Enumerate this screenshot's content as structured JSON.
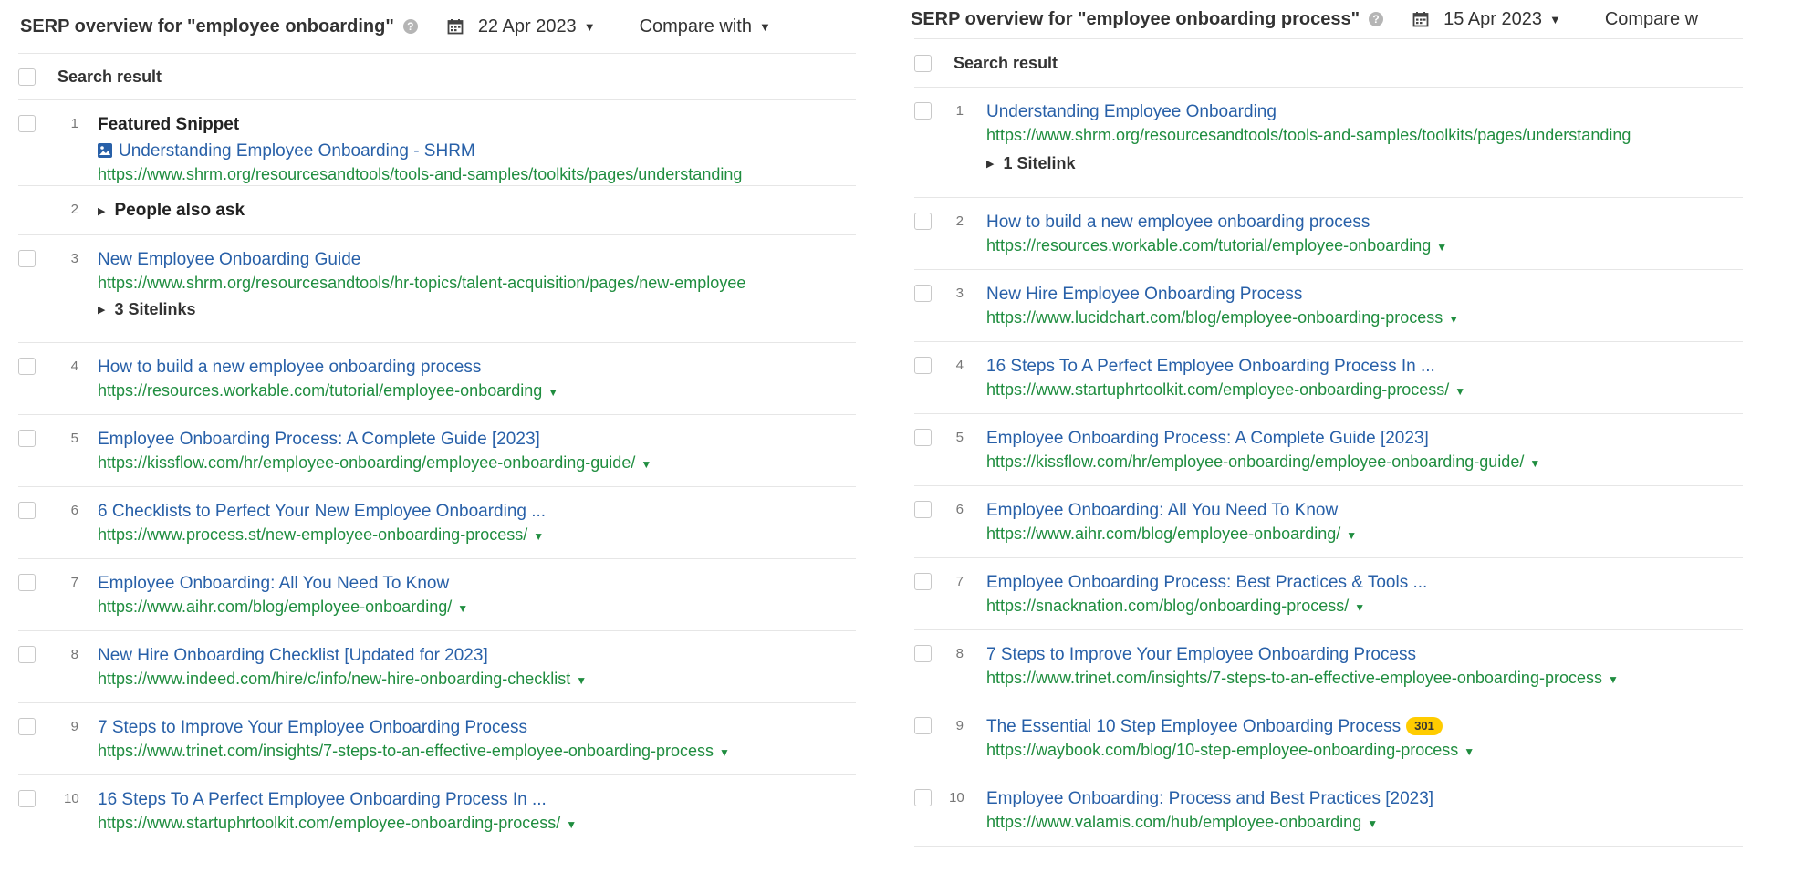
{
  "left": {
    "title": "SERP overview for \"employee onboarding\"",
    "date": "22 Apr 2023",
    "compare_label": "Compare with",
    "column_header": "Search result",
    "rows": [
      {
        "num": "1",
        "label": "Featured Snippet",
        "title": "Understanding Employee Onboarding - SHRM",
        "url": "https://www.shrm.org/resourcesandtools/tools-and-samples/toolkits/pages/understanding"
      },
      {
        "num": "2",
        "label": "People also ask"
      },
      {
        "num": "3",
        "title": "New Employee Onboarding Guide",
        "url": "https://www.shrm.org/resourcesandtools/hr-topics/talent-acquisition/pages/new-employee",
        "sitelinks": "3 Sitelinks"
      },
      {
        "num": "4",
        "title": "How to build a new employee onboarding process",
        "url": "https://resources.workable.com/tutorial/employee-onboarding"
      },
      {
        "num": "5",
        "title": "Employee Onboarding Process: A Complete Guide [2023]",
        "url": "https://kissflow.com/hr/employee-onboarding/employee-onboarding-guide/"
      },
      {
        "num": "6",
        "title": "6 Checklists to Perfect Your New Employee Onboarding ...",
        "url": "https://www.process.st/new-employee-onboarding-process/"
      },
      {
        "num": "7",
        "title": "Employee Onboarding: All You Need To Know",
        "url": "https://www.aihr.com/blog/employee-onboarding/"
      },
      {
        "num": "8",
        "title": "New Hire Onboarding Checklist [Updated for 2023]",
        "url": "https://www.indeed.com/hire/c/info/new-hire-onboarding-checklist"
      },
      {
        "num": "9",
        "title": "7 Steps to Improve Your Employee Onboarding Process",
        "url": "https://www.trinet.com/insights/7-steps-to-an-effective-employee-onboarding-process"
      },
      {
        "num": "10",
        "title": "16 Steps To A Perfect Employee Onboarding Process In ...",
        "url": "https://www.startuphrtoolkit.com/employee-onboarding-process/"
      }
    ]
  },
  "right": {
    "title": "SERP overview for \"employee onboarding process\"",
    "date": "15 Apr 2023",
    "compare_label": "Compare w",
    "column_header": "Search result",
    "rows": [
      {
        "num": "1",
        "title": "Understanding Employee Onboarding",
        "url": "https://www.shrm.org/resourcesandtools/tools-and-samples/toolkits/pages/understanding",
        "sitelinks": "1 Sitelink"
      },
      {
        "num": "2",
        "title": "How to build a new employee onboarding process",
        "url": "https://resources.workable.com/tutorial/employee-onboarding"
      },
      {
        "num": "3",
        "title": "New Hire Employee Onboarding Process",
        "url": "https://www.lucidchart.com/blog/employee-onboarding-process"
      },
      {
        "num": "4",
        "title": "16 Steps To A Perfect Employee Onboarding Process In ...",
        "url": "https://www.startuphrtoolkit.com/employee-onboarding-process/"
      },
      {
        "num": "5",
        "title": "Employee Onboarding Process: A Complete Guide [2023]",
        "url": "https://kissflow.com/hr/employee-onboarding/employee-onboarding-guide/"
      },
      {
        "num": "6",
        "title": "Employee Onboarding: All You Need To Know",
        "url": "https://www.aihr.com/blog/employee-onboarding/"
      },
      {
        "num": "7",
        "title": "Employee Onboarding Process: Best Practices & Tools ...",
        "url": "https://snacknation.com/blog/onboarding-process/"
      },
      {
        "num": "8",
        "title": "7 Steps to Improve Your Employee Onboarding Process",
        "url": "https://www.trinet.com/insights/7-steps-to-an-effective-employee-onboarding-process"
      },
      {
        "num": "9",
        "title": "The Essential 10 Step Employee Onboarding Process",
        "badge": "301",
        "url": "https://waybook.com/blog/10-step-employee-onboarding-process"
      },
      {
        "num": "10",
        "title": "Employee Onboarding: Process and Best Practices [2023]",
        "url": "https://www.valamis.com/hub/employee-onboarding"
      }
    ]
  },
  "icons": {
    "help": "question-circle-icon",
    "calendar": "calendar-icon",
    "caret": "caret-down-icon",
    "expand": "triangle-right-icon",
    "image": "image-icon"
  },
  "colors": {
    "title_link": "#2860a8",
    "url": "#1f8d3f",
    "badge": "#ffcc00"
  }
}
